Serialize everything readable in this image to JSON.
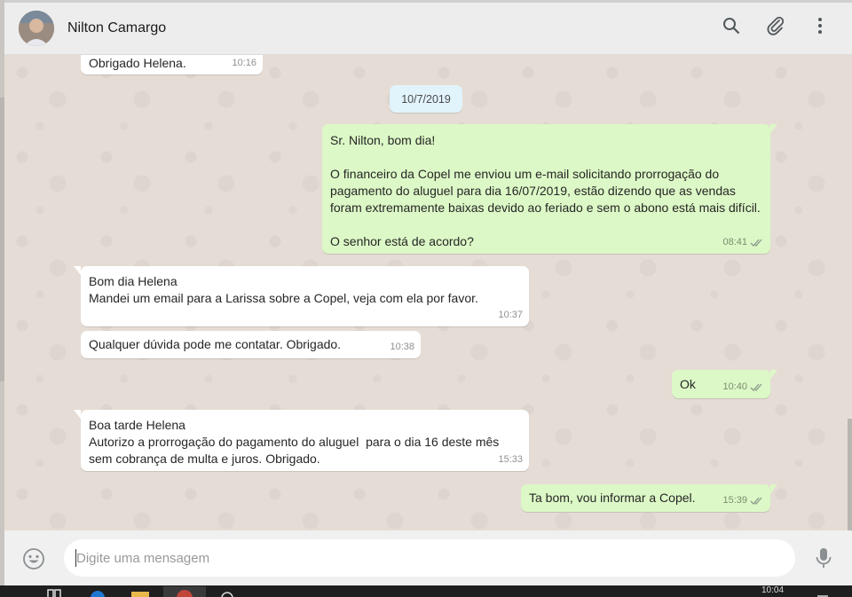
{
  "header": {
    "contact_name": "Nilton Camargo",
    "icons": [
      "search-icon",
      "attach-icon",
      "menu-icon"
    ]
  },
  "chat": {
    "date_chip": "10/7/2019",
    "messages": [
      {
        "direction": "in",
        "text": "Obrigado Helena.",
        "time": "10:16"
      },
      {
        "direction": "out",
        "text": "Sr. Nilton, bom dia!\n\nO financeiro da Copel me enviou um e-mail solicitando prorrogação do\npagamento do aluguel para dia 16/07/2019, estão dizendo que as vendas\nforam extremamente baixas devido ao feriado e sem o abono está mais difícil.\n\nO senhor está de acordo?",
        "time": "08:41",
        "status": "read"
      },
      {
        "direction": "in",
        "text": "Bom dia Helena\nMandei um email para a Larissa sobre a Copel, veja com ela por favor.",
        "time": "10:37"
      },
      {
        "direction": "in",
        "text": "Qualquer dúvida pode me contatar. Obrigado.",
        "time": "10:38"
      },
      {
        "direction": "out",
        "text": "Ok",
        "time": "10:40",
        "status": "read"
      },
      {
        "direction": "in",
        "text": "Boa tarde Helena\nAutorizo a prorrogação do pagamento do aluguel  para o dia 16 deste mês\nsem cobrança de multa e juros. Obrigado.",
        "time": "15:33"
      },
      {
        "direction": "out",
        "text": "Ta bom, vou informar a Copel.",
        "time": "15:39",
        "status": "read"
      }
    ]
  },
  "composer": {
    "placeholder": "Digite uma mensagem",
    "value": ""
  },
  "taskbar": {
    "clock": "10:04"
  },
  "colors": {
    "outgoing_bubble": "#dcf8c6",
    "incoming_bubble": "#ffffff",
    "chat_background": "#e5ddd5",
    "date_chip": "#e1f3fb"
  }
}
